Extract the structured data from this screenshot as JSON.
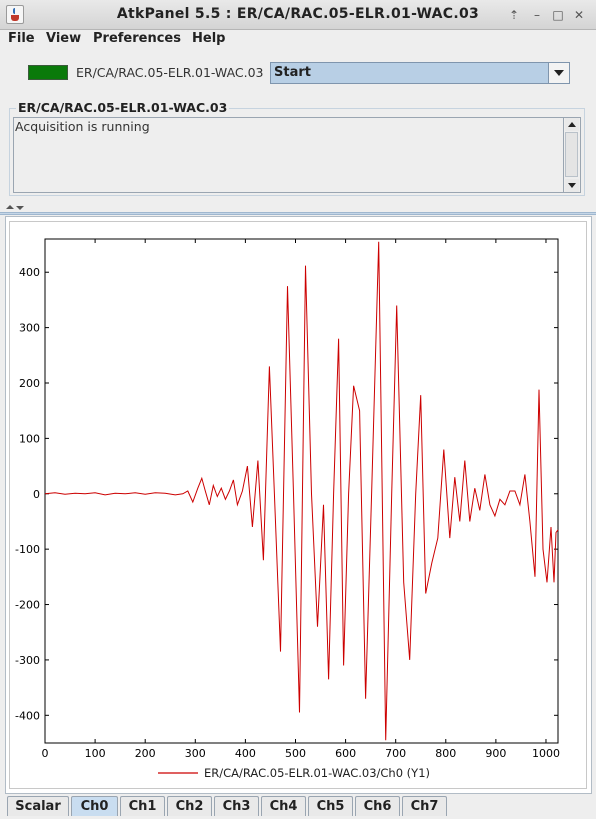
{
  "window": {
    "title": "AtkPanel  5.5  : ER/CA/RAC.05-ELR.01-WAC.03",
    "icon": "java-cup-icon",
    "controls": [
      "pin-icon",
      "minimize-icon",
      "maximize-icon",
      "close-icon"
    ]
  },
  "menu": {
    "file": "File",
    "view": "View",
    "preferences": "Preferences",
    "help": "Help"
  },
  "device": {
    "name": "ER/CA/RAC.05-ELR.01-WAC.03",
    "state_color": "#0a7a0a",
    "command_selected": "Start"
  },
  "status": {
    "title": "ER/CA/RAC.05-ELR.01-WAC.03",
    "text": "Acquisition is running"
  },
  "tabs": [
    "Scalar",
    "Ch0",
    "Ch1",
    "Ch2",
    "Ch3",
    "Ch4",
    "Ch5",
    "Ch6",
    "Ch7"
  ],
  "active_tab": "Ch0",
  "chart_data": {
    "type": "line",
    "title": "",
    "xlabel": "",
    "ylabel": "",
    "xlim": [
      0,
      1024
    ],
    "ylim": [
      -450,
      460
    ],
    "xticks": [
      0,
      100,
      200,
      300,
      400,
      500,
      600,
      700,
      800,
      900,
      1000
    ],
    "yticks": [
      400,
      300,
      200,
      100,
      0,
      -100,
      -200,
      -300,
      -400
    ],
    "grid": false,
    "legend_position": "bottom-center",
    "series": [
      {
        "name": "ER/CA/RAC.05-ELR.01-WAC.03/Ch0 (Y1)",
        "color": "#cc0000",
        "x": [
          0,
          20,
          40,
          60,
          80,
          100,
          120,
          140,
          160,
          180,
          200,
          220,
          240,
          260,
          275,
          285,
          295,
          305,
          313,
          320,
          328,
          336,
          344,
          352,
          360,
          368,
          376,
          384,
          394,
          404,
          414,
          425,
          436,
          448,
          458,
          470,
          484,
          496,
          508,
          520,
          532,
          544,
          556,
          566,
          576,
          586,
          596,
          606,
          616,
          628,
          640,
          652,
          666,
          680,
          692,
          702,
          716,
          728,
          740,
          750,
          760,
          772,
          784,
          796,
          808,
          818,
          828,
          838,
          848,
          858,
          868,
          878,
          888,
          898,
          908,
          918,
          928,
          938,
          948,
          958,
          968,
          978,
          986,
          994,
          1002,
          1010,
          1016,
          1020,
          1024
        ],
        "values": [
          0,
          2,
          -1,
          1,
          0,
          2,
          -2,
          1,
          0,
          2,
          -1,
          2,
          1,
          -2,
          0,
          5,
          -15,
          10,
          28,
          5,
          -20,
          15,
          -5,
          10,
          -10,
          5,
          25,
          -20,
          5,
          50,
          -60,
          60,
          -120,
          230,
          0,
          -285,
          375,
          0,
          -395,
          412,
          0,
          -240,
          -20,
          -335,
          0,
          280,
          -310,
          0,
          195,
          150,
          -370,
          0,
          455,
          -445,
          0,
          340,
          -160,
          -300,
          0,
          178,
          -180,
          -125,
          -80,
          80,
          -80,
          30,
          -50,
          60,
          -50,
          10,
          -30,
          35,
          -20,
          -40,
          -10,
          -20,
          5,
          5,
          -20,
          35,
          -50,
          -150,
          188,
          -100,
          -160,
          -60,
          -160,
          -70,
          -65
        ]
      }
    ]
  }
}
